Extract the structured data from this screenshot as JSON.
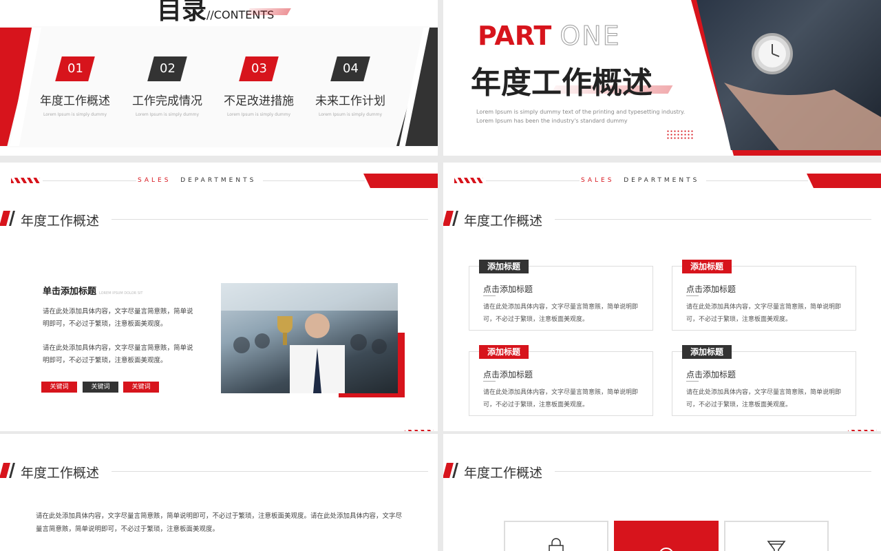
{
  "toc": {
    "title": "目录",
    "title_sub": "//CONTENTS",
    "items": [
      {
        "num": "01",
        "label": "年度工作概述",
        "sub": "Lorem Ipsum is simply dummy",
        "color": "#d7141c"
      },
      {
        "num": "02",
        "label": "工作完成情况",
        "sub": "Lorem Ipsum is simply dummy",
        "color": "#333333"
      },
      {
        "num": "03",
        "label": "不足改进措施",
        "sub": "Lorem Ipsum is simply dummy",
        "color": "#d7141c"
      },
      {
        "num": "04",
        "label": "未来工作计划",
        "sub": "Lorem Ipsum is simply dummy",
        "color": "#333333"
      }
    ]
  },
  "part": {
    "part_word": "PART",
    "one_word": "ONE",
    "title": "年度工作概述",
    "desc_line1": "Lorem Ipsum is simply dummy text of the printing and typesetting industry.",
    "desc_line2": "Lorem Ipsum has been the industry's standard dummy"
  },
  "header": {
    "sales": "SALES",
    "departments": "DEPARTMENTS"
  },
  "section_title": "年度工作概述",
  "slide3": {
    "heading": "单击添加标题",
    "heading_sub": "LOREM IPSUM DOLOR SIT",
    "para1": "请在此处添加具体内容，文字尽量言简意赅，简单说明即可，不必过于繁琐，注意板面美观度。",
    "para2": "请在此处添加具体内容，文字尽量言简意赅，简单说明即可，不必过于繁琐，注意板面美观度。",
    "keywords": [
      "关键词",
      "关键词",
      "关键词"
    ]
  },
  "slide4": {
    "cards": [
      {
        "tag": "添加标题",
        "tag_color": "#333333",
        "heading": "点击添加标题",
        "text": "请在此处添加具体内容，文字尽量言简意赅，简单说明即可，不必过于繁琐，注意板面美观度。"
      },
      {
        "tag": "添加标题",
        "tag_color": "#d7141c",
        "heading": "点击添加标题",
        "text": "请在此处添加具体内容，文字尽量言简意赅，简单说明即可，不必过于繁琐，注意板面美观度。"
      },
      {
        "tag": "添加标题",
        "tag_color": "#d7141c",
        "heading": "点击添加标题",
        "text": "请在此处添加具体内容，文字尽量言简意赅，简单说明即可，不必过于繁琐，注意板面美观度。"
      },
      {
        "tag": "添加标题",
        "tag_color": "#333333",
        "heading": "点击添加标题",
        "text": "请在此处添加具体内容，文字尽量言简意赅，简单说明即可，不必过于繁琐，注意板面美观度。"
      }
    ]
  },
  "slide5": {
    "para": "请在此处添加具体内容，文字尽量言简意赅，简单说明即可，不必过于繁琐，注意板面美观度。请在此处添加具体内容，文字尽量言简意赅，简单说明即可，不必过于繁琐，注意板面美观度。"
  },
  "colors": {
    "accent": "#d7141c",
    "dark": "#333333"
  }
}
